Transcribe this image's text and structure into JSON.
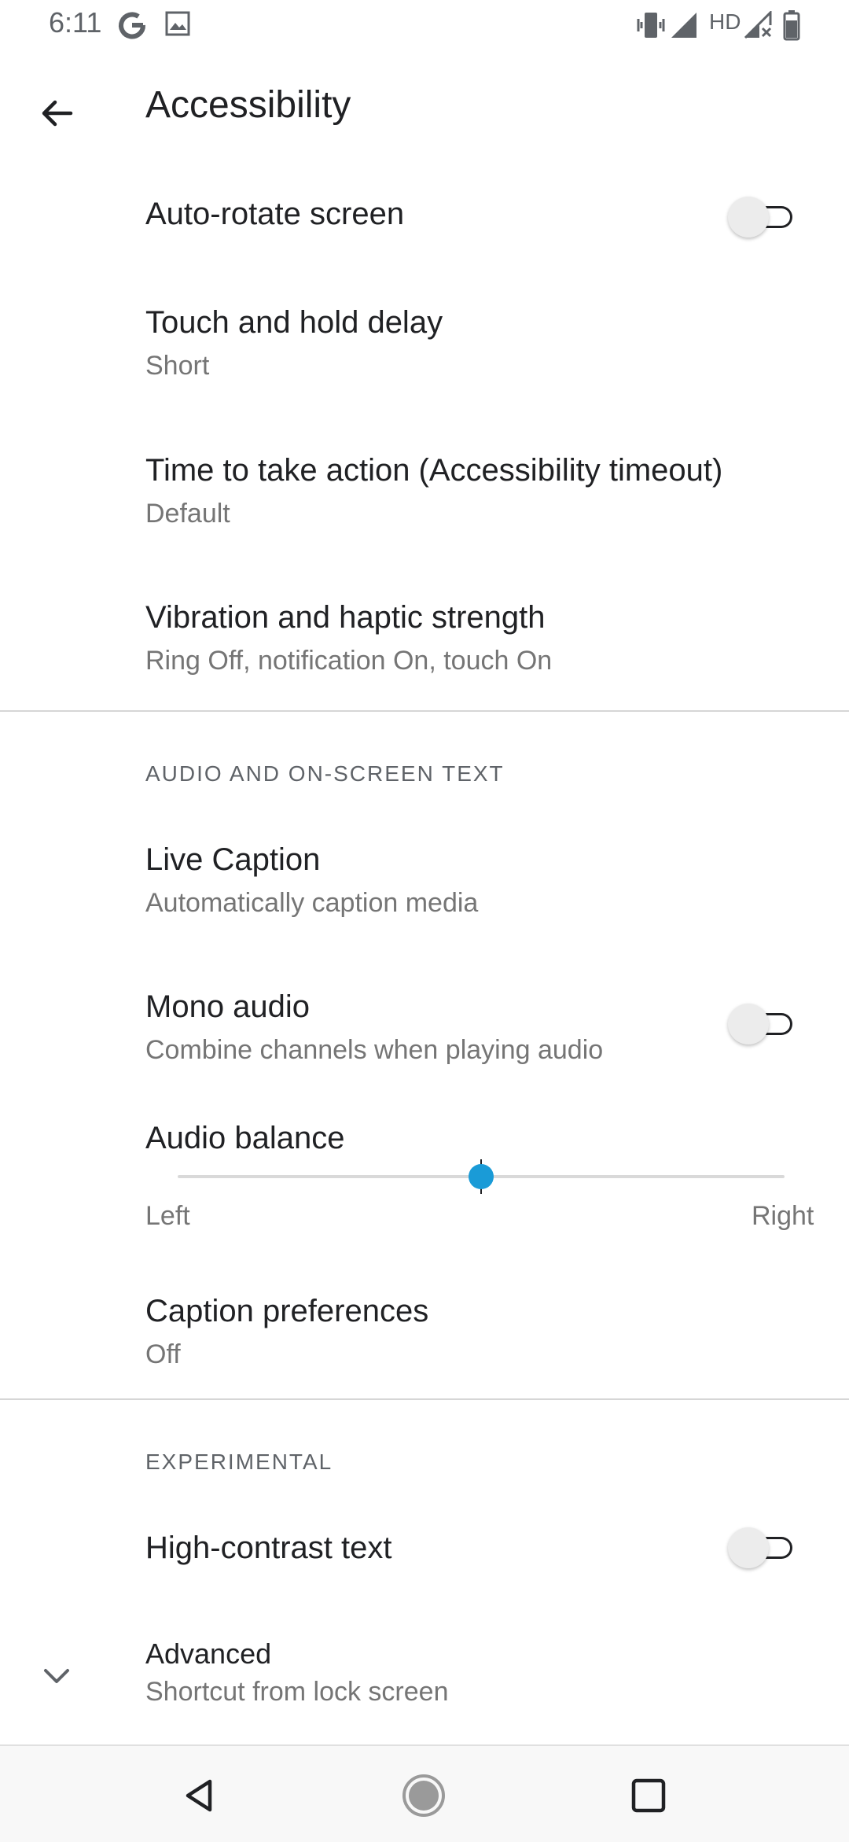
{
  "status_bar": {
    "time": "6:11",
    "icons": [
      "google-icon",
      "image-icon",
      "vibrate-icon",
      "signal-icon",
      "hd-label",
      "signal-x-icon",
      "battery-icon"
    ],
    "hd_label": "HD"
  },
  "header": {
    "title": "Accessibility",
    "back_icon": "arrow-back-icon"
  },
  "settings": {
    "auto_rotate": {
      "title": "Auto-rotate screen",
      "toggle_on": false
    },
    "touch_hold": {
      "title": "Touch and hold delay",
      "summary": "Short"
    },
    "time_action": {
      "title": "Time to take action (Accessibility timeout)",
      "summary": "Default"
    },
    "vibration": {
      "title": "Vibration and haptic strength",
      "summary": "Ring Off, notification On, touch On"
    }
  },
  "audio_section": {
    "header": "AUDIO AND ON-SCREEN TEXT",
    "live_caption": {
      "title": "Live Caption",
      "summary": "Automatically caption media"
    },
    "mono_audio": {
      "title": "Mono audio",
      "summary": "Combine channels when playing audio",
      "toggle_on": false
    },
    "audio_balance": {
      "title": "Audio balance",
      "left_label": "Left",
      "right_label": "Right",
      "value": 0.5
    },
    "caption_prefs": {
      "title": "Caption preferences",
      "summary": "Off"
    }
  },
  "experimental_section": {
    "header": "EXPERIMENTAL",
    "high_contrast": {
      "title": "High-contrast text",
      "toggle_on": false
    },
    "advanced": {
      "title": "Advanced",
      "summary": "Shortcut from lock screen",
      "icon": "chevron-down-icon"
    }
  },
  "nav_bar": {
    "icons": [
      "nav-back-icon",
      "nav-home-icon",
      "nav-recents-icon"
    ]
  },
  "colors": {
    "accent": "#1a9bd7",
    "text_primary": "#202124",
    "text_secondary": "#757575"
  }
}
